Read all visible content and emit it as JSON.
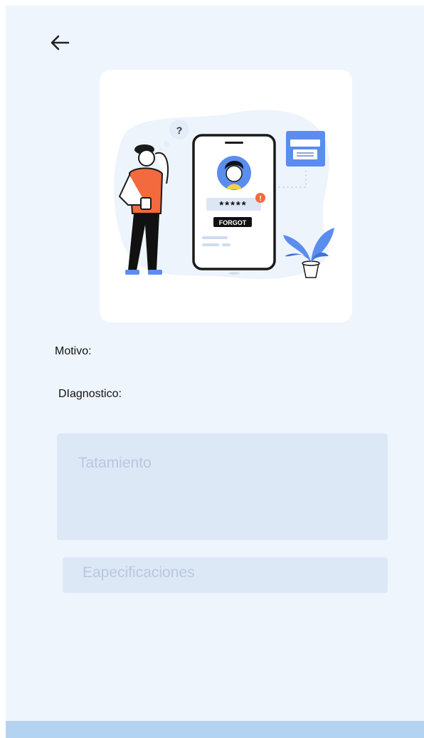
{
  "icons": {
    "back": "arrow-left-icon",
    "illustration": "forgot-password-illustration"
  },
  "illustration": {
    "question_mark": "?",
    "password_mask": "*****",
    "alert": "!",
    "forgot_button": "FORGOT"
  },
  "form": {
    "motivo_label": "Motivo:",
    "diagnostico_label": "DIagnostico:",
    "tratamiento_placeholder": "Tatamiento",
    "especificaciones_placeholder": "Eapecificaciones"
  },
  "colors": {
    "background": "#eff5fd",
    "field": "#dde8f7",
    "placeholder": "#b8c8de",
    "accent_blue": "#5b8def",
    "accent_orange": "#f26a3d",
    "bottom_bar": "#b3d3f0"
  }
}
